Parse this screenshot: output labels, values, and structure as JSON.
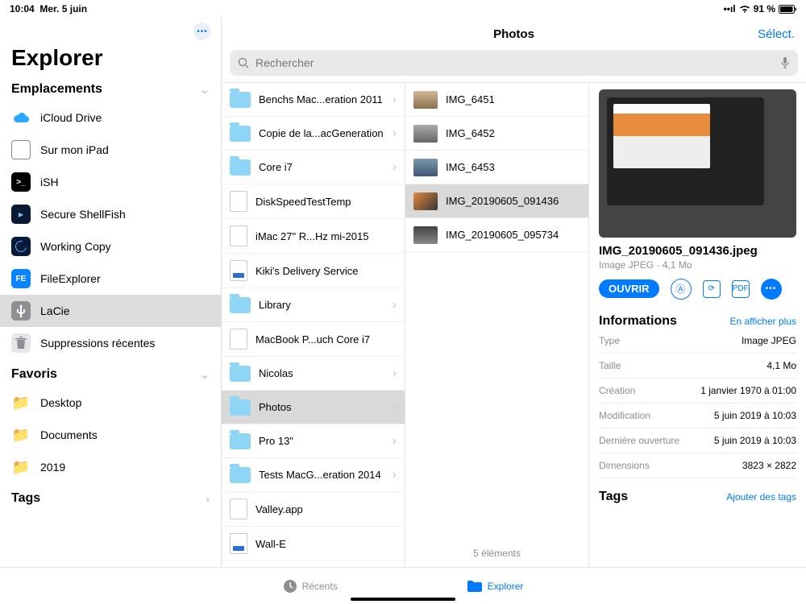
{
  "statusbar": {
    "time": "10:04",
    "date": "Mer. 5 juin",
    "battery": "91 %"
  },
  "sidebar": {
    "title": "Explorer",
    "sections": {
      "locations": {
        "header": "Emplacements",
        "items": [
          "iCloud Drive",
          "Sur mon iPad",
          "iSH",
          "Secure ShellFish",
          "Working Copy",
          "FileExplorer",
          "LaCie",
          "Suppressions récentes"
        ]
      },
      "favorites": {
        "header": "Favoris",
        "items": [
          "Desktop",
          "Documents",
          "2019"
        ]
      },
      "tags": {
        "header": "Tags"
      }
    }
  },
  "header": {
    "title": "Photos",
    "select": "Sélect.",
    "search_placeholder": "Rechercher"
  },
  "col1": [
    {
      "name": "Benchs Mac...eration 2011",
      "type": "folder",
      "chevron": true
    },
    {
      "name": "Copie de la...acGeneration",
      "type": "folder",
      "chevron": true
    },
    {
      "name": "Core i7",
      "type": "folder",
      "chevron": true
    },
    {
      "name": "DiskSpeedTestTemp",
      "type": "file"
    },
    {
      "name": "iMac 27\" R...Hz mi-2015",
      "type": "file"
    },
    {
      "name": "Kiki's Delivery Service",
      "type": "video"
    },
    {
      "name": "Library",
      "type": "folder",
      "chevron": true
    },
    {
      "name": "MacBook P...uch Core i7",
      "type": "file"
    },
    {
      "name": "Nicolas",
      "type": "folder",
      "chevron": true
    },
    {
      "name": "Photos",
      "type": "folder",
      "chevron": true,
      "selected": true
    },
    {
      "name": "Pro 13\"",
      "type": "folder",
      "chevron": true
    },
    {
      "name": "Tests MacG...eration 2014",
      "type": "folder",
      "chevron": true
    },
    {
      "name": "Valley.app",
      "type": "file"
    },
    {
      "name": "Wall-E",
      "type": "video"
    }
  ],
  "col2": {
    "items": [
      {
        "name": "IMG_6451",
        "tb": "tb1"
      },
      {
        "name": "IMG_6452",
        "tb": "tb2"
      },
      {
        "name": "IMG_6453",
        "tb": "tb3"
      },
      {
        "name": "IMG_20190605_091436",
        "tb": "tb4",
        "selected": true
      },
      {
        "name": "IMG_20190605_095734",
        "tb": "tb5"
      }
    ],
    "count": "5 éléments"
  },
  "preview": {
    "filename": "IMG_20190605_091436.jpeg",
    "meta": "Image JPEG · 4,1 Mo",
    "open": "OUVRIR",
    "info_title": "Informations",
    "show_more": "En afficher plus",
    "rows": [
      {
        "k": "Type",
        "v": "Image JPEG"
      },
      {
        "k": "Taille",
        "v": "4,1 Mo"
      },
      {
        "k": "Création",
        "v": "1 janvier 1970 à 01:00"
      },
      {
        "k": "Modification",
        "v": "5 juin 2019 à 10:03"
      },
      {
        "k": "Dernière ouverture",
        "v": "5 juin 2019 à 10:03"
      },
      {
        "k": "Dimensions",
        "v": "3823 × 2822"
      }
    ],
    "tags_title": "Tags",
    "add_tags": "Ajouter des tags"
  },
  "bottombar": {
    "recent": "Récents",
    "browse": "Explorer"
  }
}
